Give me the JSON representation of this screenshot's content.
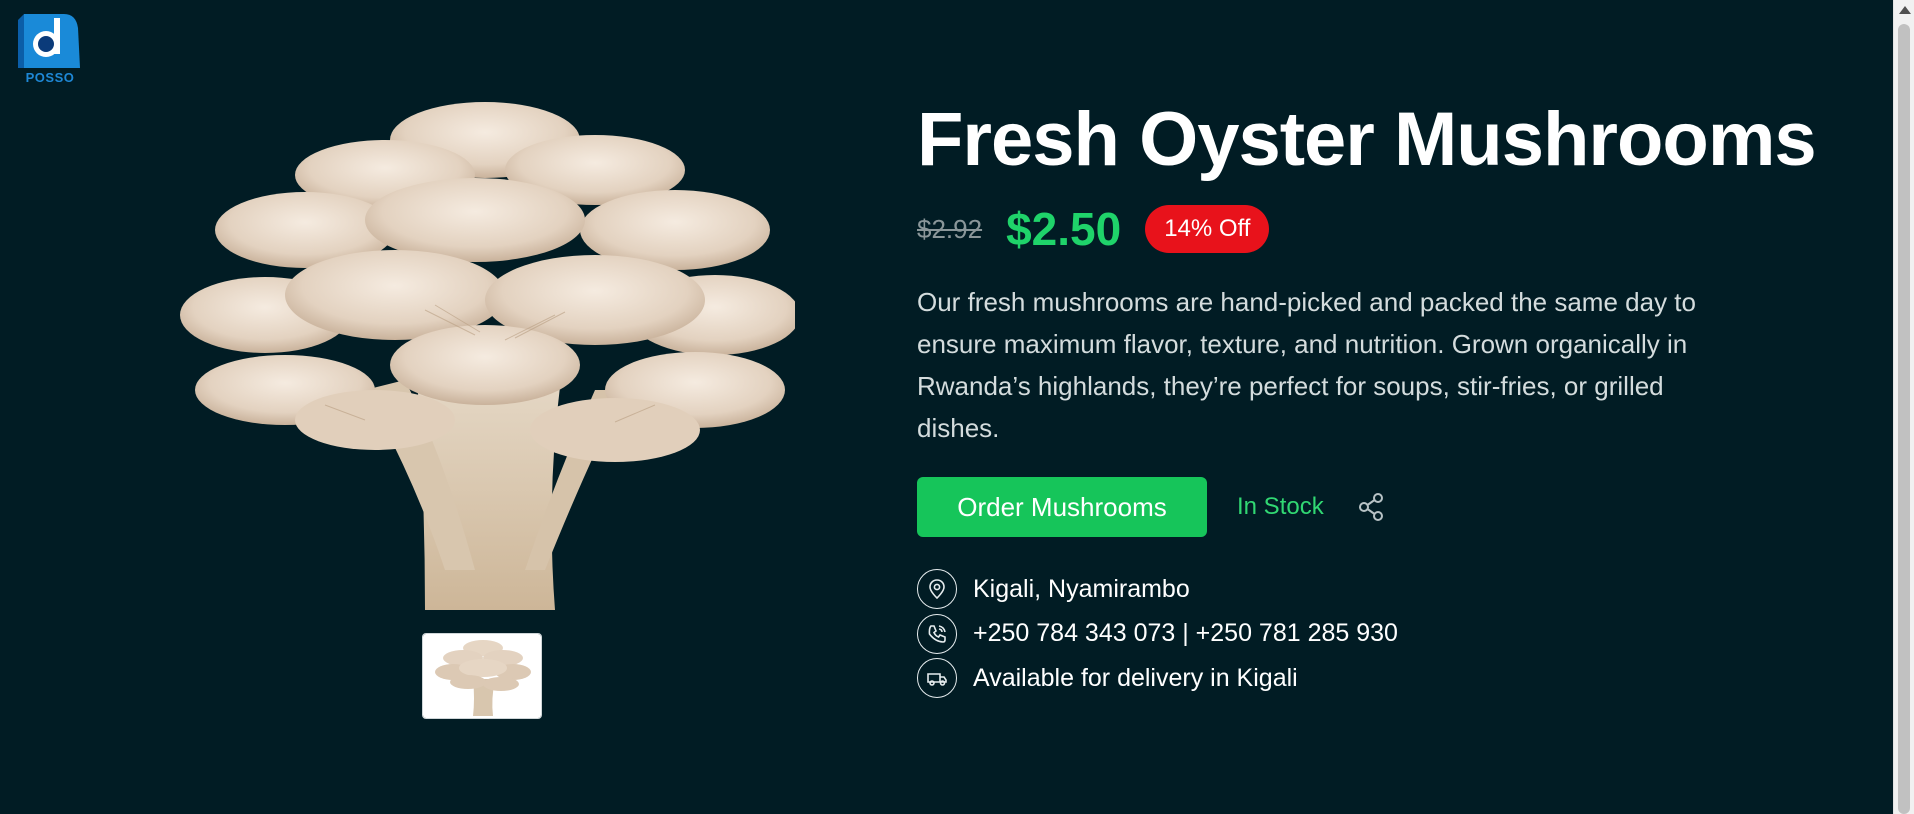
{
  "brand": {
    "logo_text": "POSSO"
  },
  "product": {
    "title": "Fresh Oyster Mushrooms",
    "old_price": "$2.92",
    "price": "$2.50",
    "discount_badge": "14% Off",
    "description": "Our fresh mushrooms are hand-picked and packed the same day to ensure maximum flavor, texture, and nutrition. Grown organically in Rwanda’s highlands, they’re perfect for soups, stir-fries, or grilled dishes.",
    "order_button": "Order Mushrooms",
    "stock_status": "In Stock"
  },
  "contact": {
    "location": "Kigali, Nyamirambo",
    "phones": "+250 784 343 073 | +250 781 285 930",
    "delivery": "Available for delivery in Kigali"
  },
  "icons": {
    "location": "location-pin-icon",
    "phone": "phone-icon",
    "delivery": "delivery-truck-icon",
    "share": "share-icon"
  },
  "colors": {
    "background": "#011c24",
    "accent_green": "#16c55a",
    "price_green": "#1fd36a",
    "badge_red": "#e8121b"
  }
}
